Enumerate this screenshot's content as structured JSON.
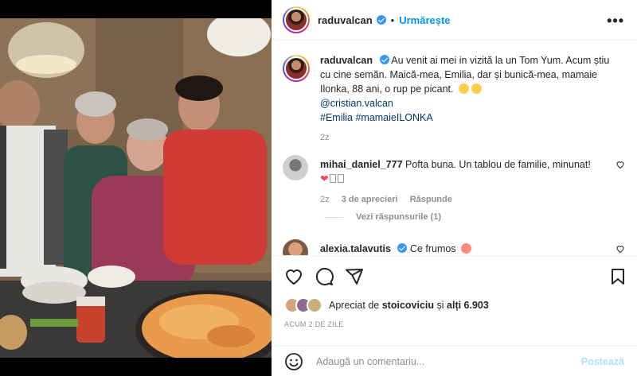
{
  "header": {
    "username": "raduvalcan",
    "dot": "•",
    "follow_label": "Urmărește",
    "more_label": "•••"
  },
  "caption": {
    "username": "raduvalcan",
    "text": "Au venit ai mei in vizită la un Tom Yum. Acum știu cu cine semăn. Maică-mea, Emilia, dar și bunică-mea, mamaie Ilonka, 88 ani, o rup pe picant.",
    "mention": "@cristian.valcan",
    "hashtags": "#Emilia #mamaieILONKA",
    "age": "2z"
  },
  "comments": [
    {
      "username": "mihai_daniel_777",
      "text": "Pofta buna. Un tablou de familie, minunat!",
      "extra": "❤",
      "age": "2z",
      "likes": "3 de aprecieri",
      "reply": "Răspunde",
      "view_replies": "Vezi răspunsurile (1)"
    },
    {
      "username": "alexia.talavutis",
      "text": "Ce frumos"
    }
  ],
  "likes": {
    "prefix": "Apreciat de",
    "user": "stoicoviciu",
    "connector": "și",
    "others": "alți 6.903"
  },
  "timestamp": "ACUM 2 DE ZILE",
  "comment_input": {
    "placeholder": "Adaugă un comentariu..."
  },
  "post_label": "Postează",
  "colors": {
    "accent": "#0095f6",
    "verified": "#3897f0",
    "post_disabled": "#b2dffc"
  }
}
